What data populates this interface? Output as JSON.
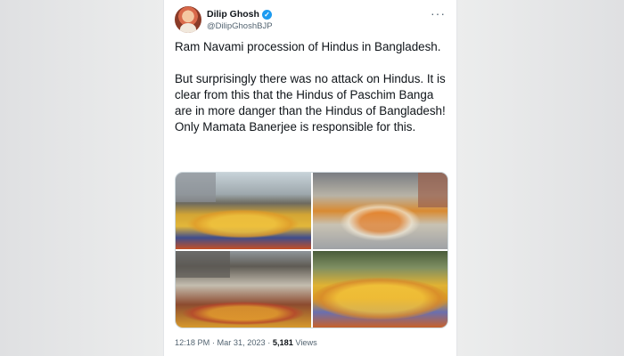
{
  "tweet": {
    "author_name": "Dilip Ghosh",
    "author_handle": "@DilipGhoshBJP",
    "verified_icon": "✓",
    "more_icon": "···",
    "paragraph1": "Ram Navami procession of Hindus in Bangladesh.",
    "paragraph2": "But surprisingly there was no attack on Hindus. It is clear from this that the Hindus of Paschim Banga are in more danger than the Hindus of Bangladesh! Only Mamata Banerjee is responsible for this.",
    "time": "12:18 PM",
    "date": "Mar 31, 2023",
    "separator": "·",
    "views_count": "5,181",
    "views_label": "Views"
  },
  "colors": {
    "verified": "#1d9bf0",
    "text_primary": "#0f1419",
    "text_secondary": "#536471"
  },
  "media": {
    "photo_count": 4
  }
}
